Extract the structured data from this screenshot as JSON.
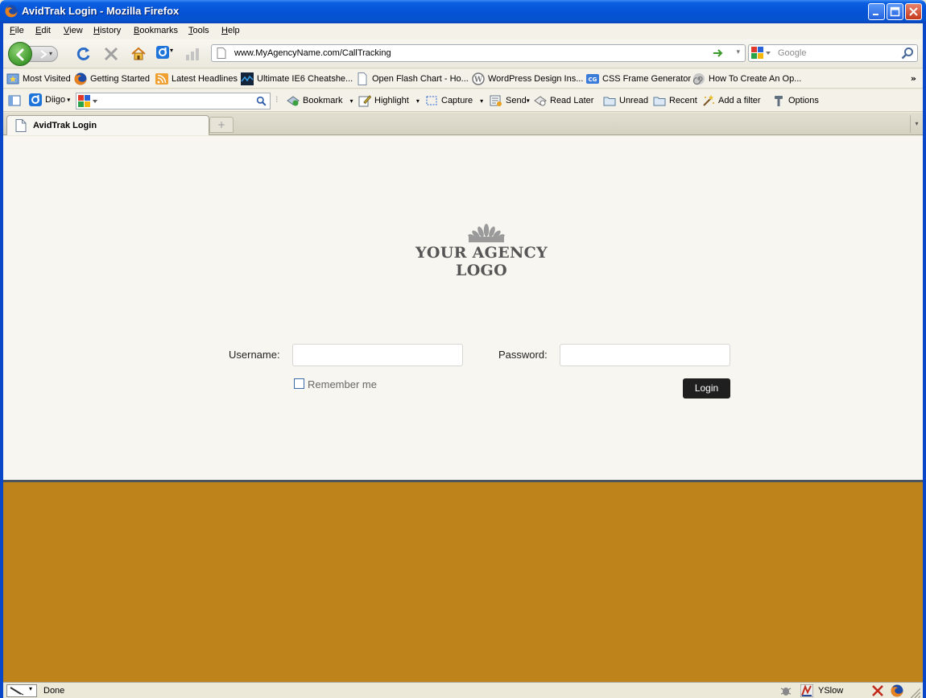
{
  "window": {
    "title": "AvidTrak Login - Mozilla Firefox",
    "controls": [
      "minimize",
      "maximize",
      "close"
    ]
  },
  "menu": [
    "File",
    "Edit",
    "View",
    "History",
    "Bookmarks",
    "Tools",
    "Help"
  ],
  "navigation": {
    "url": "www.MyAgencyName.com/CallTracking",
    "search_placeholder": "Google"
  },
  "bookmarks": [
    {
      "label": "Most Visited",
      "icon": "bookmarks-star-icon"
    },
    {
      "label": "Getting Started",
      "icon": "firefox-icon"
    },
    {
      "label": "Latest Headlines",
      "icon": "rss-icon"
    },
    {
      "label": "Ultimate IE6 Cheatshe...",
      "icon": "site-icon"
    },
    {
      "label": "Open Flash Chart - Ho...",
      "icon": "page-icon"
    },
    {
      "label": "WordPress Design Ins...",
      "icon": "wordpress-icon"
    },
    {
      "label": "CSS Frame Generator",
      "icon": "css-icon"
    },
    {
      "label": "How To Create An Op...",
      "icon": "spiral-icon"
    }
  ],
  "diigo_toolbar": {
    "diigo_label": "Diigo",
    "items": [
      {
        "label": "Bookmark",
        "icon": "bookmark-icon"
      },
      {
        "label": "Highlight",
        "icon": "highlight-icon"
      },
      {
        "label": "Capture",
        "icon": "capture-icon"
      },
      {
        "label": "Send",
        "icon": "send-icon"
      },
      {
        "label": "Read Later",
        "icon": "read-later-icon"
      },
      {
        "label": "Unread",
        "icon": "folder-icon"
      },
      {
        "label": "Recent",
        "icon": "folder-icon"
      },
      {
        "label": "Add a filter",
        "icon": "filter-icon"
      },
      {
        "label": "Options",
        "icon": "options-icon"
      }
    ]
  },
  "tabs": [
    {
      "label": "AvidTrak Login",
      "active": true
    }
  ],
  "page": {
    "logo_text": "YOUR AGENCY LOGO",
    "username_label": "Username:",
    "password_label": "Password:",
    "username_value": "",
    "password_value": "",
    "remember_label": "Remember me",
    "remember_checked": false,
    "login_label": "Login",
    "colors": {
      "background": "#f8f6f0",
      "footer_band": "#be841b",
      "button": "#1f1f1f"
    }
  },
  "status": {
    "text": "Done",
    "yslow_label": "YSlow"
  }
}
